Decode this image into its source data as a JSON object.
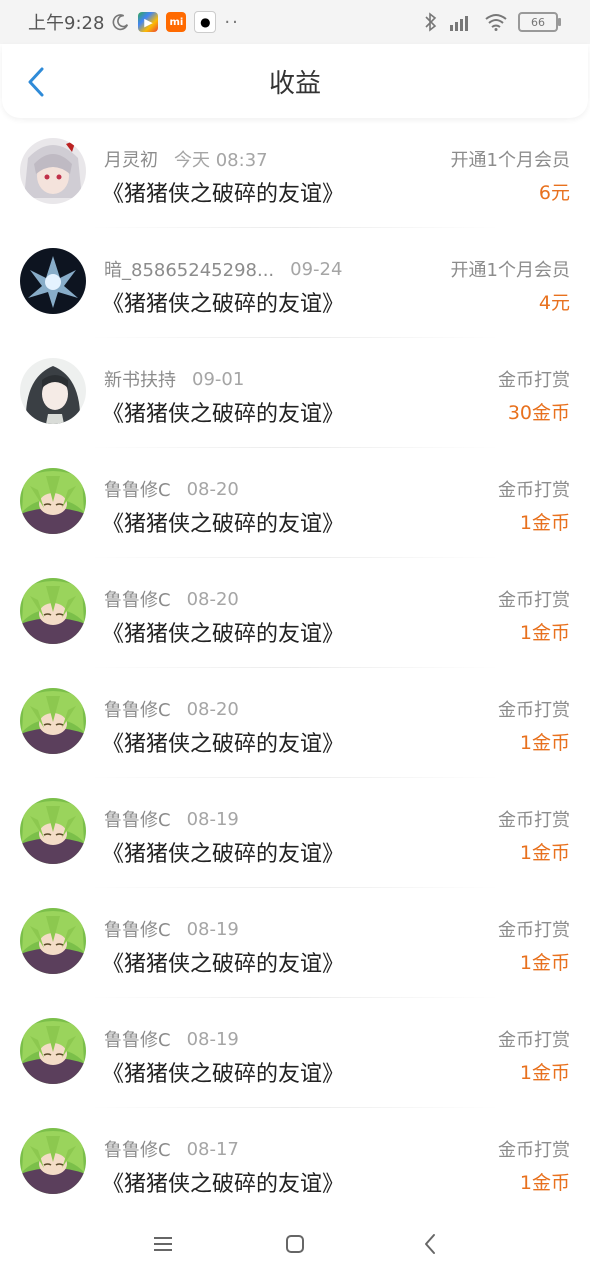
{
  "status_bar": {
    "time": "上午9:28",
    "battery": "66",
    "icons": [
      "moon-icon",
      "play-store-icon",
      "mi-icon",
      "qq-icon",
      "bluetooth-icon",
      "signal-icon",
      "wifi-icon",
      "battery-icon"
    ]
  },
  "header": {
    "title": "收益",
    "back_icon": "chevron-left-icon"
  },
  "items": [
    {
      "user": "月灵初",
      "time": "今天 08:37",
      "book": "《猪猪侠之破碎的友谊》",
      "type": "开通1个月会员",
      "amount": "6元",
      "avatar": "avatar-white-hair"
    },
    {
      "user": "暗_85865245298...",
      "time": "09-24",
      "book": "《猪猪侠之破碎的友谊》",
      "type": "开通1个月会员",
      "amount": "4元",
      "avatar": "avatar-ice-crystal"
    },
    {
      "user": "新书扶持",
      "time": "09-01",
      "book": "《猪猪侠之破碎的友谊》",
      "type": "金币打赏",
      "amount": "30金币",
      "avatar": "avatar-dark-hair"
    },
    {
      "user": "鲁鲁修C",
      "time": "08-20",
      "book": "《猪猪侠之破碎的友谊》",
      "type": "金币打赏",
      "amount": "1金币",
      "avatar": "avatar-green-hair"
    },
    {
      "user": "鲁鲁修C",
      "time": "08-20",
      "book": "《猪猪侠之破碎的友谊》",
      "type": "金币打赏",
      "amount": "1金币",
      "avatar": "avatar-green-hair"
    },
    {
      "user": "鲁鲁修C",
      "time": "08-20",
      "book": "《猪猪侠之破碎的友谊》",
      "type": "金币打赏",
      "amount": "1金币",
      "avatar": "avatar-green-hair"
    },
    {
      "user": "鲁鲁修C",
      "time": "08-19",
      "book": "《猪猪侠之破碎的友谊》",
      "type": "金币打赏",
      "amount": "1金币",
      "avatar": "avatar-green-hair"
    },
    {
      "user": "鲁鲁修C",
      "time": "08-19",
      "book": "《猪猪侠之破碎的友谊》",
      "type": "金币打赏",
      "amount": "1金币",
      "avatar": "avatar-green-hair"
    },
    {
      "user": "鲁鲁修C",
      "time": "08-19",
      "book": "《猪猪侠之破碎的友谊》",
      "type": "金币打赏",
      "amount": "1金币",
      "avatar": "avatar-green-hair"
    },
    {
      "user": "鲁鲁修C",
      "time": "08-17",
      "book": "《猪猪侠之破碎的友谊》",
      "type": "金币打赏",
      "amount": "1金币",
      "avatar": "avatar-green-hair"
    }
  ],
  "colors": {
    "accent_blue": "#2f8bd8",
    "amount_orange": "#e8711e",
    "text_dark": "#222222",
    "text_gray": "#8c8c8c"
  },
  "nav_bar": {
    "icons": [
      "menu-icon",
      "home-icon",
      "back-icon"
    ]
  }
}
